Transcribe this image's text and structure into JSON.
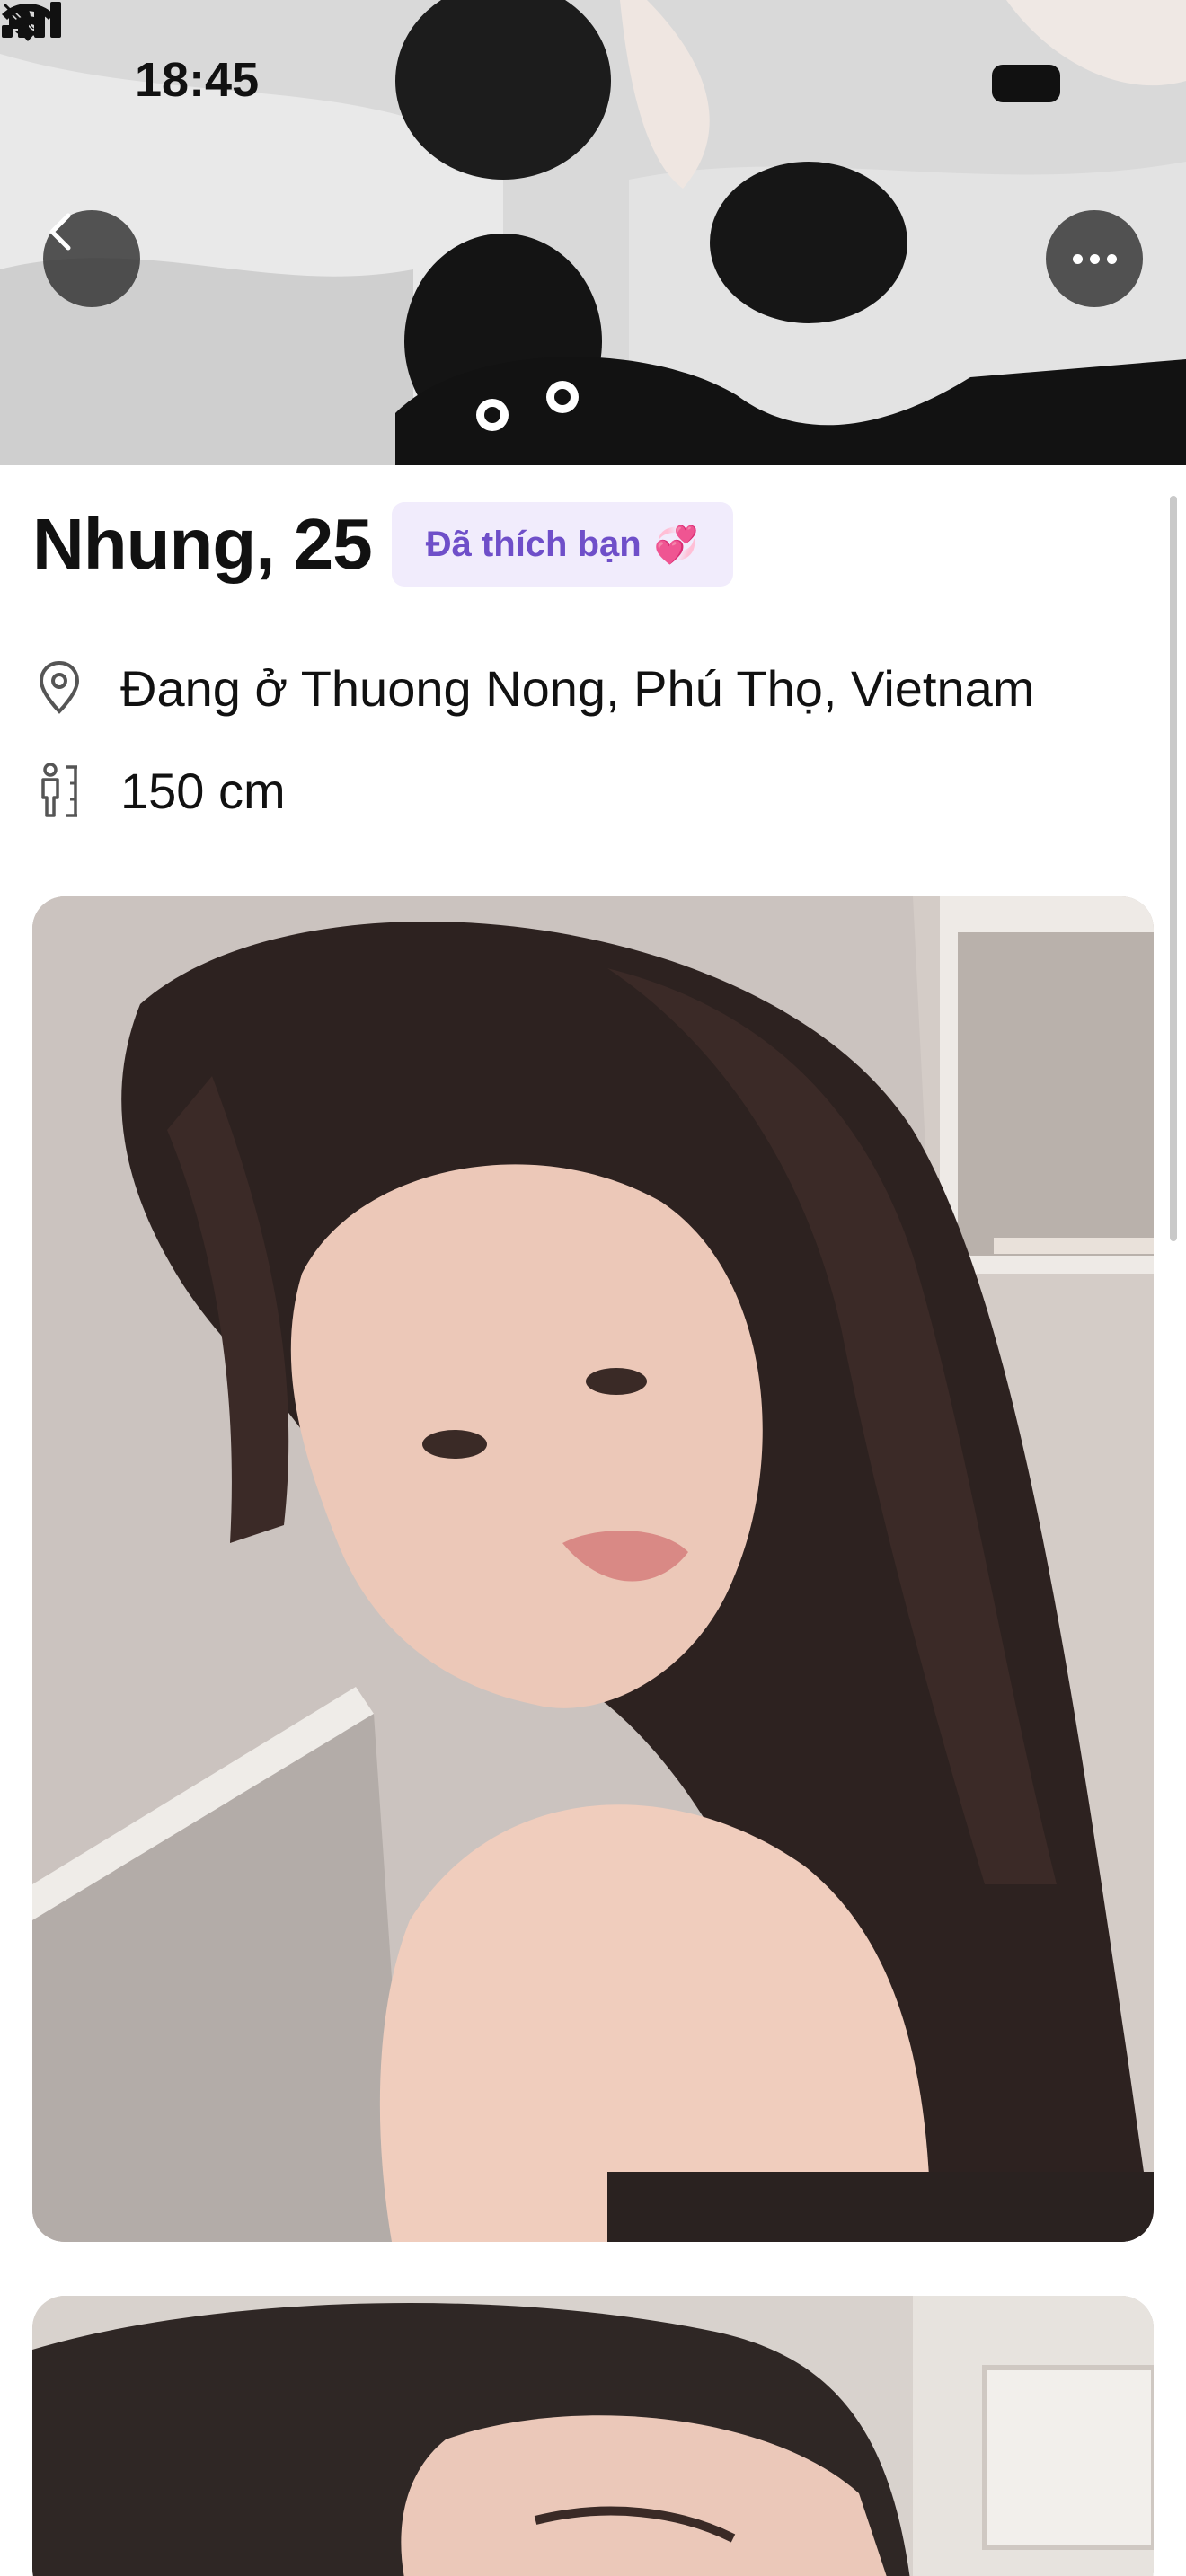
{
  "status_bar": {
    "time": "18:45",
    "silent_icon": "bell-slash-icon",
    "signal_icon": "cellular-signal-icon",
    "wifi_icon": "wifi-icon",
    "battery_icon": "battery-icon"
  },
  "hero": {
    "back_icon": "chevron-left-icon",
    "more_icon": "more-horizontal-icon"
  },
  "profile": {
    "name_age": "Nhung, 25",
    "liked_badge": "Đã thích bạn",
    "liked_badge_icon": "💞",
    "location": "Đang ở Thuong Nong, Phú Thọ, Vietnam",
    "location_icon": "location-pin-icon",
    "height": "150 cm",
    "height_icon": "person-height-icon"
  },
  "colors": {
    "badge_bg": "#f1ecfc",
    "badge_text": "#6f4fc9",
    "overlay_button": "#282828"
  }
}
